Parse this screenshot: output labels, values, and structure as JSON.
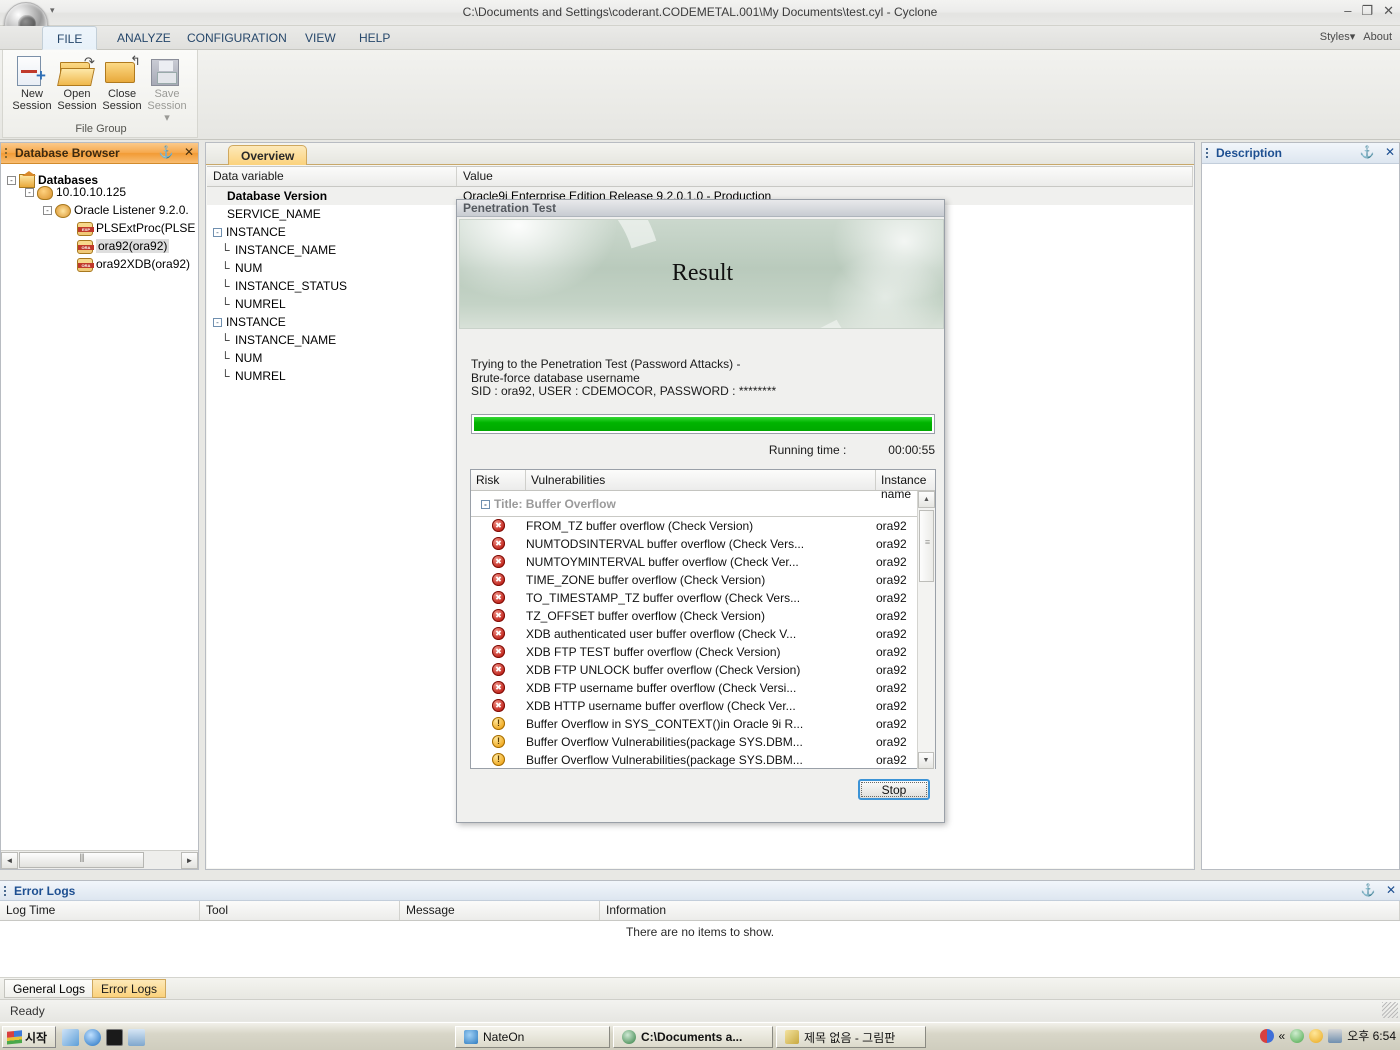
{
  "window": {
    "title": "C:\\Documents and Settings\\coderant.CODEMETAL.001\\My Documents\\test.cyl - Cyclone",
    "minimize": "–",
    "restore": "❐",
    "close": "✕",
    "qat_arrow": "▾"
  },
  "ribbon": {
    "tabs": [
      {
        "label": "FILE",
        "active": true
      },
      {
        "label": "ANALYZE",
        "active": false
      },
      {
        "label": "CONFIGURATION",
        "active": false
      },
      {
        "label": "VIEW",
        "active": false
      },
      {
        "label": "HELP",
        "active": false
      }
    ],
    "right": {
      "styles": "Styles",
      "styles_caret": "▾",
      "about": "About"
    },
    "group_label": "File Group",
    "buttons": [
      {
        "line1": "New",
        "line2": "Session",
        "disabled": false
      },
      {
        "line1": "Open",
        "line2": "Session",
        "disabled": false
      },
      {
        "line1": "Close",
        "line2": "Session",
        "disabled": false
      },
      {
        "line1": "Save",
        "line2": "Session ▾",
        "disabled": true
      }
    ]
  },
  "database_browser": {
    "title": "Database Browser",
    "pin": "⚓",
    "close": "✕",
    "tree": [
      {
        "label": "Databases",
        "depth": 0,
        "box": "-",
        "icon": "home",
        "bold": true,
        "selected": false
      },
      {
        "label": "10.10.10.125",
        "depth": 1,
        "box": "-",
        "icon": "users",
        "bold": false,
        "selected": false
      },
      {
        "label": "Oracle Listener 9.2.0.",
        "depth": 2,
        "box": "-",
        "icon": "ear",
        "bold": false,
        "selected": false
      },
      {
        "label": "PLSExtProc(PLSE",
        "depth": 3,
        "box": "",
        "icon": "db",
        "bold": false,
        "selected": false
      },
      {
        "label": "ora92(ora92)",
        "depth": 3,
        "box": "",
        "icon": "db",
        "bold": false,
        "selected": true
      },
      {
        "label": "ora92XDB(ora92)",
        "depth": 3,
        "box": "",
        "icon": "db",
        "bold": false,
        "selected": false
      }
    ],
    "scroll_left": "◄",
    "scroll_right": "►"
  },
  "workspace": {
    "tab": "Overview",
    "columns": [
      "Data variable",
      "Value"
    ],
    "rows": [
      {
        "name": "Database Version",
        "value": "Oracle9i Enterprise Edition Release 9.2.0.1.0 - Production",
        "bold": true,
        "indent": 1,
        "box": "",
        "conn": "",
        "alt": true
      },
      {
        "name": "SERVICE_NAME",
        "value": "",
        "bold": false,
        "indent": 1,
        "box": "",
        "conn": "",
        "alt": false
      },
      {
        "name": "INSTANCE",
        "value": "",
        "bold": false,
        "indent": 0,
        "box": "-",
        "conn": "",
        "alt": false
      },
      {
        "name": "INSTANCE_NAME",
        "value": "",
        "bold": false,
        "indent": 1,
        "box": "",
        "conn": "└",
        "alt": false
      },
      {
        "name": "NUM",
        "value": "",
        "bold": false,
        "indent": 1,
        "box": "",
        "conn": "└",
        "alt": false
      },
      {
        "name": "INSTANCE_STATUS",
        "value": "",
        "bold": false,
        "indent": 1,
        "box": "",
        "conn": "└",
        "alt": false
      },
      {
        "name": "NUMREL",
        "value": "",
        "bold": false,
        "indent": 1,
        "box": "",
        "conn": "└",
        "alt": false
      },
      {
        "name": "INSTANCE",
        "value": "",
        "bold": false,
        "indent": 0,
        "box": "-",
        "conn": "",
        "alt": false
      },
      {
        "name": "INSTANCE_NAME",
        "value": "",
        "bold": false,
        "indent": 1,
        "box": "",
        "conn": "└",
        "alt": false
      },
      {
        "name": "NUM",
        "value": "",
        "bold": false,
        "indent": 1,
        "box": "",
        "conn": "└",
        "alt": false
      },
      {
        "name": "NUMREL",
        "value": "",
        "bold": false,
        "indent": 1,
        "box": "",
        "conn": "└",
        "alt": false
      }
    ]
  },
  "description_panel": {
    "title": "Description",
    "pin": "⚓",
    "close": "✕"
  },
  "dialog": {
    "title": "Penetration Test",
    "banner_title": "Result",
    "message_lines": [
      "Trying to the Penetration Test (Password Attacks) -",
      "Brute-force database username",
      "SID : ora92, USER : CDEMOCOR, PASSWORD : ********"
    ],
    "progress_percent": 100,
    "progress_color": "#00b400",
    "runtime_label": "Running time :",
    "runtime_value": "00:00:55",
    "stop_label": "Stop",
    "table": {
      "columns": [
        "Risk",
        "Vulnerabilities",
        "Instance name"
      ],
      "group_box": "-",
      "group_label": "Title: Buffer Overflow",
      "rows": [
        {
          "risk": "red",
          "vuln": "FROM_TZ buffer overflow (Check Version)",
          "instance": "ora92"
        },
        {
          "risk": "red",
          "vuln": "NUMTODSINTERVAL buffer overflow (Check Vers...",
          "instance": "ora92"
        },
        {
          "risk": "red",
          "vuln": "NUMTOYMINTERVAL buffer overflow (Check Ver...",
          "instance": "ora92"
        },
        {
          "risk": "red",
          "vuln": "TIME_ZONE buffer overflow (Check Version)",
          "instance": "ora92"
        },
        {
          "risk": "red",
          "vuln": "TO_TIMESTAMP_TZ buffer overflow (Check Vers...",
          "instance": "ora92"
        },
        {
          "risk": "red",
          "vuln": "TZ_OFFSET buffer overflow (Check Version)",
          "instance": "ora92"
        },
        {
          "risk": "red",
          "vuln": "XDB authenticated user buffer overflow (Check V...",
          "instance": "ora92"
        },
        {
          "risk": "red",
          "vuln": "XDB FTP TEST buffer overflow (Check Version)",
          "instance": "ora92"
        },
        {
          "risk": "red",
          "vuln": "XDB FTP UNLOCK buffer overflow (Check Version)",
          "instance": "ora92"
        },
        {
          "risk": "red",
          "vuln": "XDB FTP username buffer overflow (Check Versi...",
          "instance": "ora92"
        },
        {
          "risk": "red",
          "vuln": "XDB HTTP username buffer overflow (Check Ver...",
          "instance": "ora92"
        },
        {
          "risk": "yellow",
          "vuln": "Buffer Overflow in SYS_CONTEXT()in Oracle 9i R...",
          "instance": "ora92"
        },
        {
          "risk": "yellow",
          "vuln": "Buffer Overflow Vulnerabilities(package SYS.DBM...",
          "instance": "ora92"
        },
        {
          "risk": "yellow",
          "vuln": "Buffer Overflow Vulnerabilities(package SYS.DBM...",
          "instance": "ora92"
        }
      ],
      "scroll_up": "▲",
      "scroll_down": "▼"
    }
  },
  "error_logs": {
    "title": "Error Logs",
    "pin": "⚓",
    "close": "✕",
    "columns": [
      "Log Time",
      "Tool",
      "Message",
      "Information"
    ],
    "empty_text": "There are no items to show.",
    "tabs": [
      {
        "label": "General Logs",
        "active": false
      },
      {
        "label": "Error Logs",
        "active": true
      }
    ]
  },
  "status_bar": {
    "text": "Ready"
  },
  "taskbar": {
    "start_label": "시작",
    "tasks": [
      {
        "label": "NateOn",
        "color": "#4a8fd4"
      },
      {
        "label": "C:\\Documents a...",
        "color": "#2f7d3f"
      },
      {
        "label": "제목 없음 - 그림판",
        "color": "#c8a93f"
      }
    ],
    "tray_expand": "«",
    "clock": "오후 6:54"
  }
}
